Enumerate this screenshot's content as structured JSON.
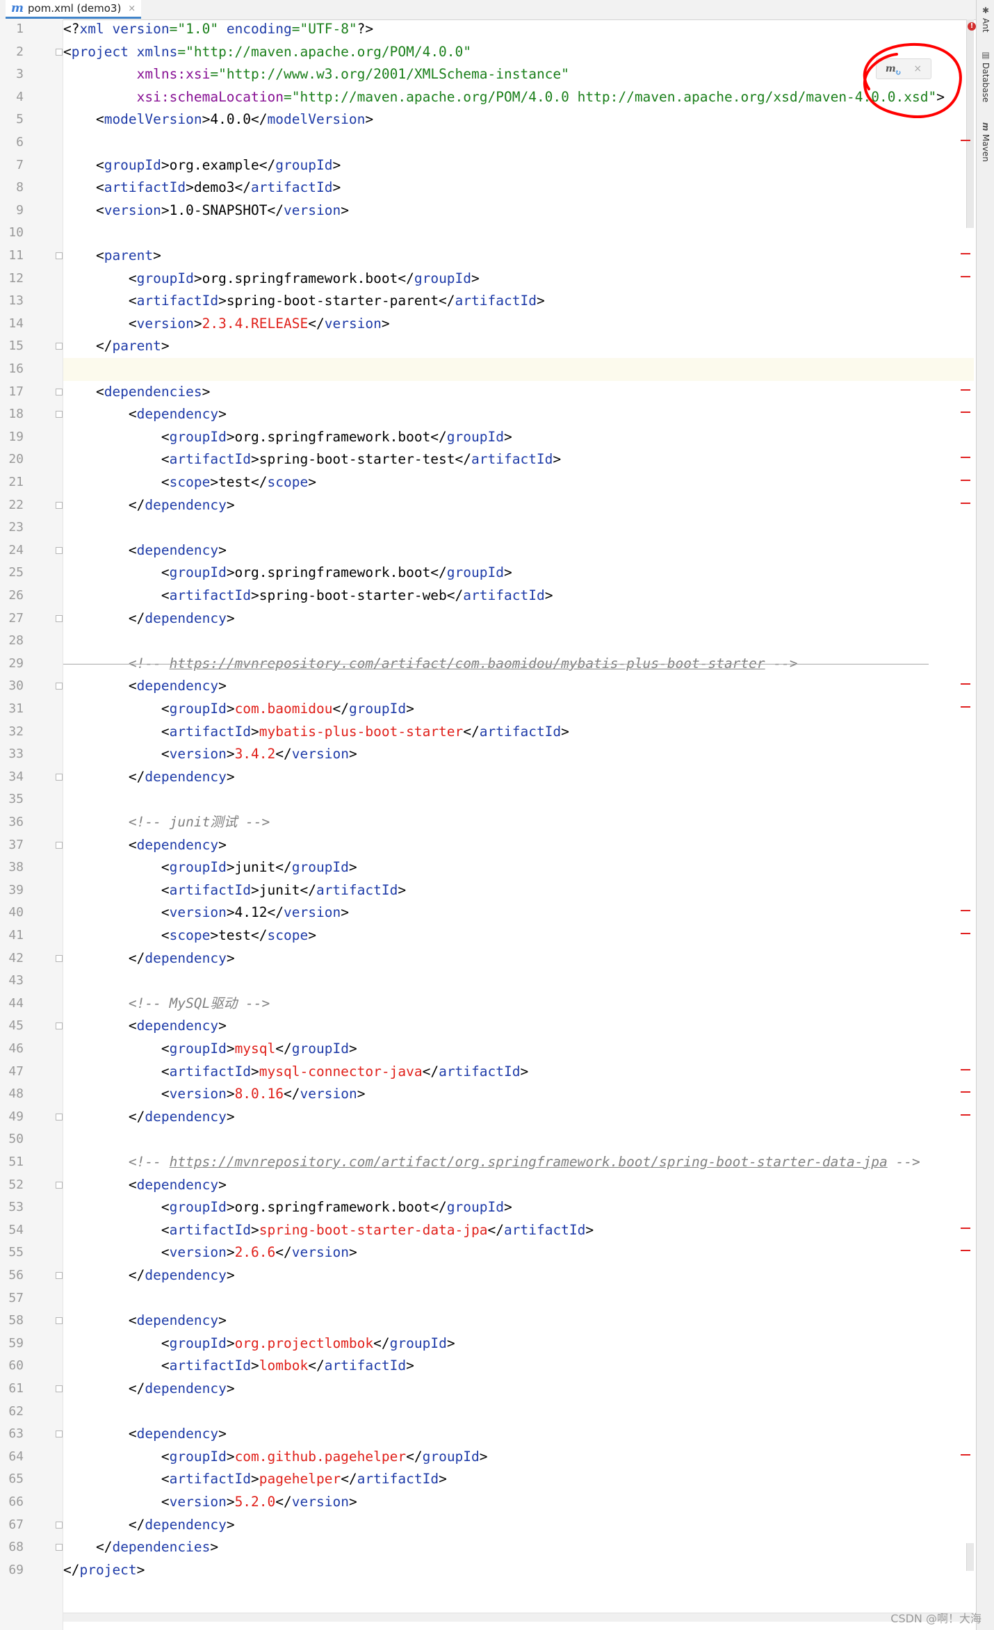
{
  "tab": {
    "icon": "maven-file-icon",
    "label": "pom.xml (demo3)",
    "close": "×"
  },
  "side_tools": [
    {
      "label": "Ant",
      "icon": "ant-icon"
    },
    {
      "label": "Database",
      "icon": "database-icon"
    },
    {
      "label": "Maven",
      "icon": "maven-icon"
    }
  ],
  "maven_popup": {
    "icon": "m",
    "close": "×"
  },
  "watermark": "CSDN @啊！大海",
  "lines": [
    [
      [
        "p",
        "<?"
      ],
      [
        "a",
        "xml "
      ],
      [
        "a",
        "version"
      ],
      [
        "v",
        "=\"1.0\" "
      ],
      [
        "a",
        "encoding"
      ],
      [
        "v",
        "=\"UTF-8\""
      ],
      [
        "p",
        "?>"
      ]
    ],
    [
      [
        "p",
        "<"
      ],
      [
        "t",
        "project "
      ],
      [
        "a",
        "xmlns"
      ],
      [
        "v",
        "=\"http://maven.apache.org/POM/4.0.0\""
      ]
    ],
    [
      [
        "p",
        "         "
      ],
      [
        "n",
        "xmlns:xsi"
      ],
      [
        "v",
        "=\"http://www.w3.org/2001/XMLSchema-instance\""
      ]
    ],
    [
      [
        "p",
        "         "
      ],
      [
        "n",
        "xsi:schemaLocation"
      ],
      [
        "v",
        "=\"http://maven.apache.org/POM/4.0.0 http://maven.apache.org/xsd/maven-4.0.0.xsd\""
      ],
      [
        "p",
        ">"
      ]
    ],
    [
      [
        "p",
        "    <"
      ],
      [
        "t",
        "modelVersion"
      ],
      [
        "p",
        ">4.0.0</"
      ],
      [
        "t",
        "modelVersion"
      ],
      [
        "p",
        ">"
      ]
    ],
    [],
    [
      [
        "p",
        "    <"
      ],
      [
        "t",
        "groupId"
      ],
      [
        "p",
        ">org.example</"
      ],
      [
        "t",
        "groupId"
      ],
      [
        "p",
        ">"
      ]
    ],
    [
      [
        "p",
        "    <"
      ],
      [
        "t",
        "artifactId"
      ],
      [
        "p",
        ">demo3</"
      ],
      [
        "t",
        "artifactId"
      ],
      [
        "p",
        ">"
      ]
    ],
    [
      [
        "p",
        "    <"
      ],
      [
        "t",
        "version"
      ],
      [
        "p",
        ">1.0-SNAPSHOT</"
      ],
      [
        "t",
        "version"
      ],
      [
        "p",
        ">"
      ]
    ],
    [],
    [
      [
        "p",
        "    <"
      ],
      [
        "t",
        "parent"
      ],
      [
        "p",
        ">"
      ]
    ],
    [
      [
        "p",
        "        <"
      ],
      [
        "t",
        "groupId"
      ],
      [
        "p",
        ">org.springframework.boot</"
      ],
      [
        "t",
        "groupId"
      ],
      [
        "p",
        ">"
      ]
    ],
    [
      [
        "p",
        "        <"
      ],
      [
        "t",
        "artifactId"
      ],
      [
        "p",
        ">spring-boot-starter-parent</"
      ],
      [
        "t",
        "artifactId"
      ],
      [
        "p",
        ">"
      ]
    ],
    [
      [
        "p",
        "        <"
      ],
      [
        "t",
        "version"
      ],
      [
        "p",
        ">"
      ],
      [
        "r",
        "2.3.4.RELEASE"
      ],
      [
        "p",
        "</"
      ],
      [
        "t",
        "version"
      ],
      [
        "p",
        ">"
      ]
    ],
    [
      [
        "p",
        "    </"
      ],
      [
        "t",
        "parent"
      ],
      [
        "p",
        ">"
      ]
    ],
    [],
    [
      [
        "p",
        "    <"
      ],
      [
        "t",
        "dependencies"
      ],
      [
        "p",
        ">"
      ]
    ],
    [
      [
        "p",
        "        <"
      ],
      [
        "t",
        "dependency"
      ],
      [
        "p",
        ">"
      ]
    ],
    [
      [
        "p",
        "            <"
      ],
      [
        "t",
        "groupId"
      ],
      [
        "p",
        ">org.springframework.boot</"
      ],
      [
        "t",
        "groupId"
      ],
      [
        "p",
        ">"
      ]
    ],
    [
      [
        "p",
        "            <"
      ],
      [
        "t",
        "artifactId"
      ],
      [
        "p",
        ">spring-boot-starter-test</"
      ],
      [
        "t",
        "artifactId"
      ],
      [
        "p",
        ">"
      ]
    ],
    [
      [
        "p",
        "            <"
      ],
      [
        "t",
        "scope"
      ],
      [
        "p",
        ">test</"
      ],
      [
        "t",
        "scope"
      ],
      [
        "p",
        ">"
      ]
    ],
    [
      [
        "p",
        "        </"
      ],
      [
        "t",
        "dependency"
      ],
      [
        "p",
        ">"
      ]
    ],
    [],
    [
      [
        "p",
        "        <"
      ],
      [
        "t",
        "dependency"
      ],
      [
        "p",
        ">"
      ]
    ],
    [
      [
        "p",
        "            <"
      ],
      [
        "t",
        "groupId"
      ],
      [
        "p",
        ">org.springframework.boot</"
      ],
      [
        "t",
        "groupId"
      ],
      [
        "p",
        ">"
      ]
    ],
    [
      [
        "p",
        "            <"
      ],
      [
        "t",
        "artifactId"
      ],
      [
        "p",
        ">spring-boot-starter-web</"
      ],
      [
        "t",
        "artifactId"
      ],
      [
        "p",
        ">"
      ]
    ],
    [
      [
        "p",
        "        </"
      ],
      [
        "t",
        "dependency"
      ],
      [
        "p",
        ">"
      ]
    ],
    [],
    [
      [
        "p",
        "        "
      ],
      [
        "c",
        "<!-- "
      ],
      [
        "l",
        "https://mvnrepository.com/artifact/com.baomidou/mybatis-plus-boot-starter"
      ],
      [
        "c",
        " -->"
      ]
    ],
    [
      [
        "p",
        "        <"
      ],
      [
        "t",
        "dependency"
      ],
      [
        "p",
        ">"
      ]
    ],
    [
      [
        "p",
        "            <"
      ],
      [
        "t",
        "groupId"
      ],
      [
        "p",
        ">"
      ],
      [
        "r",
        "com.baomidou"
      ],
      [
        "p",
        "</"
      ],
      [
        "t",
        "groupId"
      ],
      [
        "p",
        ">"
      ]
    ],
    [
      [
        "p",
        "            <"
      ],
      [
        "t",
        "artifactId"
      ],
      [
        "p",
        ">"
      ],
      [
        "r",
        "mybatis-plus-boot-starter"
      ],
      [
        "p",
        "</"
      ],
      [
        "t",
        "artifactId"
      ],
      [
        "p",
        ">"
      ]
    ],
    [
      [
        "p",
        "            <"
      ],
      [
        "t",
        "version"
      ],
      [
        "p",
        ">"
      ],
      [
        "r",
        "3.4.2"
      ],
      [
        "p",
        "</"
      ],
      [
        "t",
        "version"
      ],
      [
        "p",
        ">"
      ]
    ],
    [
      [
        "p",
        "        </"
      ],
      [
        "t",
        "dependency"
      ],
      [
        "p",
        ">"
      ]
    ],
    [],
    [
      [
        "p",
        "        "
      ],
      [
        "c",
        "<!-- junit测试 -->"
      ]
    ],
    [
      [
        "p",
        "        <"
      ],
      [
        "t",
        "dependency"
      ],
      [
        "p",
        ">"
      ]
    ],
    [
      [
        "p",
        "            <"
      ],
      [
        "t",
        "groupId"
      ],
      [
        "p",
        ">junit</"
      ],
      [
        "t",
        "groupId"
      ],
      [
        "p",
        ">"
      ]
    ],
    [
      [
        "p",
        "            <"
      ],
      [
        "t",
        "artifactId"
      ],
      [
        "p",
        ">junit</"
      ],
      [
        "t",
        "artifactId"
      ],
      [
        "p",
        ">"
      ]
    ],
    [
      [
        "p",
        "            <"
      ],
      [
        "t",
        "version"
      ],
      [
        "p",
        ">4.12</"
      ],
      [
        "t",
        "version"
      ],
      [
        "p",
        ">"
      ]
    ],
    [
      [
        "p",
        "            <"
      ],
      [
        "t",
        "scope"
      ],
      [
        "p",
        ">test</"
      ],
      [
        "t",
        "scope"
      ],
      [
        "p",
        ">"
      ]
    ],
    [
      [
        "p",
        "        </"
      ],
      [
        "t",
        "dependency"
      ],
      [
        "p",
        ">"
      ]
    ],
    [],
    [
      [
        "p",
        "        "
      ],
      [
        "c",
        "<!-- MySQL驱动 -->"
      ]
    ],
    [
      [
        "p",
        "        <"
      ],
      [
        "t",
        "dependency"
      ],
      [
        "p",
        ">"
      ]
    ],
    [
      [
        "p",
        "            <"
      ],
      [
        "t",
        "groupId"
      ],
      [
        "p",
        ">"
      ],
      [
        "r",
        "mysql"
      ],
      [
        "p",
        "</"
      ],
      [
        "t",
        "groupId"
      ],
      [
        "p",
        ">"
      ]
    ],
    [
      [
        "p",
        "            <"
      ],
      [
        "t",
        "artifactId"
      ],
      [
        "p",
        ">"
      ],
      [
        "r",
        "mysql-connector-java"
      ],
      [
        "p",
        "</"
      ],
      [
        "t",
        "artifactId"
      ],
      [
        "p",
        ">"
      ]
    ],
    [
      [
        "p",
        "            <"
      ],
      [
        "t",
        "version"
      ],
      [
        "p",
        ">"
      ],
      [
        "r",
        "8.0.16"
      ],
      [
        "p",
        "</"
      ],
      [
        "t",
        "version"
      ],
      [
        "p",
        ">"
      ]
    ],
    [
      [
        "p",
        "        </"
      ],
      [
        "t",
        "dependency"
      ],
      [
        "p",
        ">"
      ]
    ],
    [],
    [
      [
        "p",
        "        "
      ],
      [
        "c",
        "<!-- "
      ],
      [
        "l",
        "https://mvnrepository.com/artifact/org.springframework.boot/spring-boot-starter-data-jpa"
      ],
      [
        "c",
        " -->"
      ]
    ],
    [
      [
        "p",
        "        <"
      ],
      [
        "t",
        "dependency"
      ],
      [
        "p",
        ">"
      ]
    ],
    [
      [
        "p",
        "            <"
      ],
      [
        "t",
        "groupId"
      ],
      [
        "p",
        ">org.springframework.boot</"
      ],
      [
        "t",
        "groupId"
      ],
      [
        "p",
        ">"
      ]
    ],
    [
      [
        "p",
        "            <"
      ],
      [
        "t",
        "artifactId"
      ],
      [
        "p",
        ">"
      ],
      [
        "r",
        "spring-boot-starter-data-jpa"
      ],
      [
        "p",
        "</"
      ],
      [
        "t",
        "artifactId"
      ],
      [
        "p",
        ">"
      ]
    ],
    [
      [
        "p",
        "            <"
      ],
      [
        "t",
        "version"
      ],
      [
        "p",
        ">"
      ],
      [
        "r",
        "2.6.6"
      ],
      [
        "p",
        "</"
      ],
      [
        "t",
        "version"
      ],
      [
        "p",
        ">"
      ]
    ],
    [
      [
        "p",
        "        </"
      ],
      [
        "t",
        "dependency"
      ],
      [
        "p",
        ">"
      ]
    ],
    [],
    [
      [
        "p",
        "        <"
      ],
      [
        "t",
        "dependency"
      ],
      [
        "p",
        ">"
      ]
    ],
    [
      [
        "p",
        "            <"
      ],
      [
        "t",
        "groupId"
      ],
      [
        "p",
        ">"
      ],
      [
        "r",
        "org.projectlombok"
      ],
      [
        "p",
        "</"
      ],
      [
        "t",
        "groupId"
      ],
      [
        "p",
        ">"
      ]
    ],
    [
      [
        "p",
        "            <"
      ],
      [
        "t",
        "artifactId"
      ],
      [
        "p",
        ">"
      ],
      [
        "r",
        "lombok"
      ],
      [
        "p",
        "</"
      ],
      [
        "t",
        "artifactId"
      ],
      [
        "p",
        ">"
      ]
    ],
    [
      [
        "p",
        "        </"
      ],
      [
        "t",
        "dependency"
      ],
      [
        "p",
        ">"
      ]
    ],
    [],
    [
      [
        "p",
        "        <"
      ],
      [
        "t",
        "dependency"
      ],
      [
        "p",
        ">"
      ]
    ],
    [
      [
        "p",
        "            <"
      ],
      [
        "t",
        "groupId"
      ],
      [
        "p",
        ">"
      ],
      [
        "r",
        "com.github.pagehelper"
      ],
      [
        "p",
        "</"
      ],
      [
        "t",
        "groupId"
      ],
      [
        "p",
        ">"
      ]
    ],
    [
      [
        "p",
        "            <"
      ],
      [
        "t",
        "artifactId"
      ],
      [
        "p",
        ">"
      ],
      [
        "r",
        "pagehelper"
      ],
      [
        "p",
        "</"
      ],
      [
        "t",
        "artifactId"
      ],
      [
        "p",
        ">"
      ]
    ],
    [
      [
        "p",
        "            <"
      ],
      [
        "t",
        "version"
      ],
      [
        "p",
        ">"
      ],
      [
        "r",
        "5.2.0"
      ],
      [
        "p",
        "</"
      ],
      [
        "t",
        "version"
      ],
      [
        "p",
        ">"
      ]
    ],
    [
      [
        "p",
        "        </"
      ],
      [
        "t",
        "dependency"
      ],
      [
        "p",
        ">"
      ]
    ],
    [
      [
        "p",
        "    </"
      ],
      [
        "t",
        "dependencies"
      ],
      [
        "p",
        ">"
      ]
    ],
    [
      [
        "p",
        "</"
      ],
      [
        "t",
        "project"
      ],
      [
        "p",
        ">"
      ]
    ]
  ],
  "current_line": 16,
  "strikethrough_line": 29,
  "fold_lines": [
    2,
    11,
    15,
    17,
    18,
    22,
    24,
    27,
    30,
    34,
    37,
    42,
    45,
    49,
    52,
    56,
    58,
    61,
    63,
    67,
    68
  ],
  "marker_lines": [
    6,
    11,
    12,
    17,
    18,
    20,
    21,
    22,
    30,
    31,
    40,
    41,
    47,
    48,
    49,
    54,
    55,
    64
  ],
  "colors": {
    "tag": "#1e3ba8",
    "namespace": "#871094",
    "value": "#1a7f1a",
    "red_value": "#e0201a",
    "comment": "#808080",
    "annotation": "#ff0000"
  }
}
